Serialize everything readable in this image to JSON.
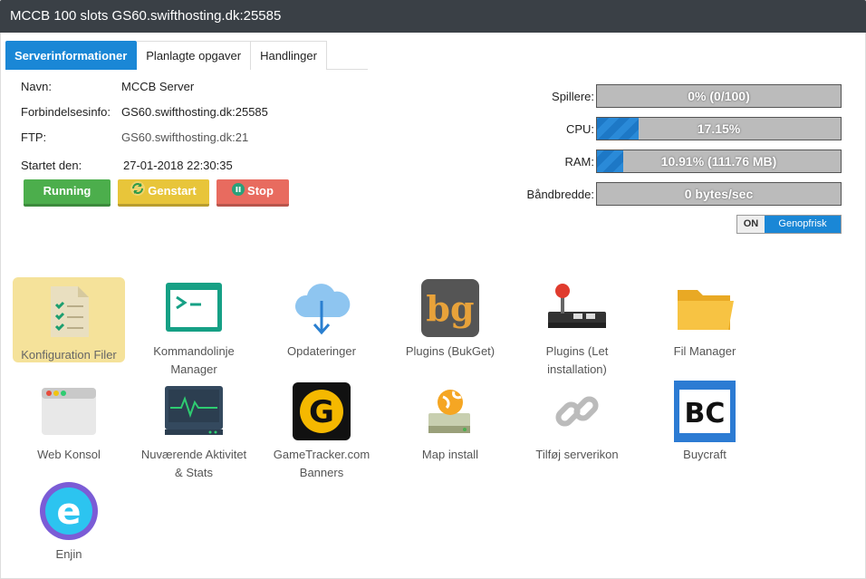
{
  "title": "MCCB 100 slots GS60.swifthosting.dk:25585",
  "tabs": [
    "Serverinformationer",
    "Planlagte opgaver",
    "Handlinger"
  ],
  "info": {
    "name_label": "Navn:",
    "name_value": "MCCB Server",
    "conn_label": "Forbindelsesinfo:",
    "conn_value": "GS60.swifthosting.dk:25585",
    "ftp_label": "FTP:",
    "ftp_value": "GS60.swifthosting.dk:21",
    "started_label": "Startet den:",
    "started_value": "27-01-2018 22:30:35"
  },
  "buttons": {
    "running": "Running",
    "restart": "Genstart",
    "stop": "Stop"
  },
  "stats": [
    {
      "label": "Spillere:",
      "text": "0% (0/100)",
      "fraction": 0
    },
    {
      "label": "CPU:",
      "text": "17.15%",
      "fraction": 0.1715
    },
    {
      "label": "RAM:",
      "text": "10.91% (111.76 MB)",
      "fraction": 0.1091
    },
    {
      "label": "Båndbredde:",
      "text": "0 bytes/sec",
      "fraction": 0
    }
  ],
  "refresh": {
    "state": "ON",
    "label": "Genopfrisk"
  },
  "tiles": [
    {
      "label": "Konfiguration Filer",
      "icon": "config-files-icon"
    },
    {
      "label": "Kommandolinje Manager",
      "icon": "terminal-icon"
    },
    {
      "label": "Opdateringer",
      "icon": "cloud-download-icon"
    },
    {
      "label": "Plugins (BukGet)",
      "icon": "bukget-icon"
    },
    {
      "label": "Plugins (Let installation)",
      "icon": "joystick-icon"
    },
    {
      "label": "Fil Manager",
      "icon": "folder-icon"
    },
    {
      "label": "Web Konsol",
      "icon": "browser-window-icon"
    },
    {
      "label": "Nuværende Aktivitet & Stats",
      "icon": "activity-monitor-icon"
    },
    {
      "label": "GameTracker.com Banners",
      "icon": "gametracker-icon"
    },
    {
      "label": "Map install",
      "icon": "map-install-icon"
    },
    {
      "label": "Tilføj serverikon",
      "icon": "link-icon"
    },
    {
      "label": "Buycraft",
      "icon": "buycraft-icon"
    },
    {
      "label": "Enjin",
      "icon": "enjin-icon"
    }
  ],
  "icon_text": {
    "bukget": "bg",
    "gametracker": "G",
    "buycraft": "BC",
    "enjin": "e"
  },
  "colors": {
    "primary": "#1a87d6",
    "running": "#4cae4c",
    "restart": "#e8c53a",
    "stop": "#e86b5f",
    "titlebar": "#3a4046"
  }
}
